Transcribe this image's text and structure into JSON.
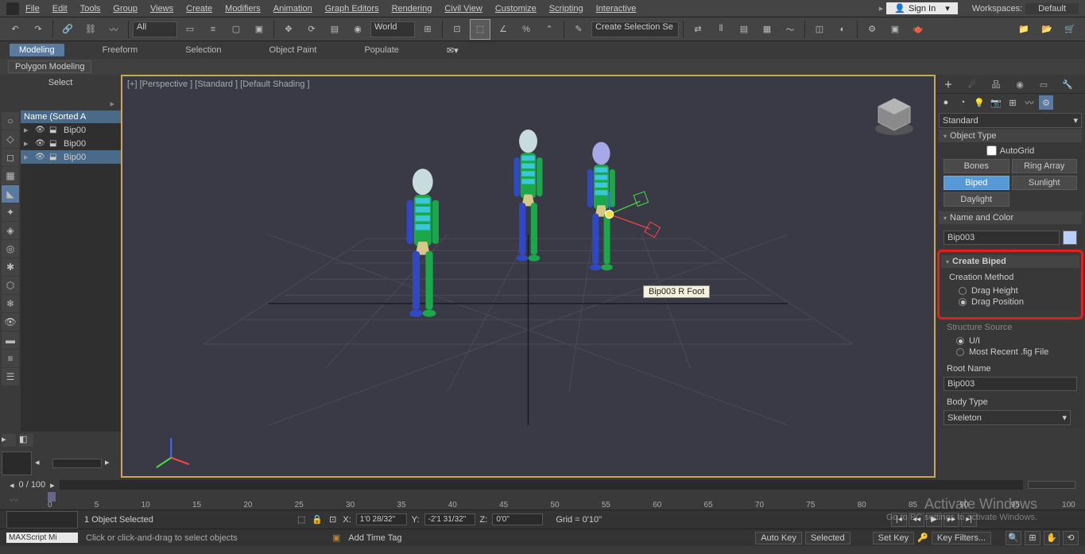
{
  "menu": {
    "items": [
      "File",
      "Edit",
      "Tools",
      "Group",
      "Views",
      "Create",
      "Modifiers",
      "Animation",
      "Graph Editors",
      "Rendering",
      "Civil View",
      "Customize",
      "Scripting",
      "Interactive"
    ],
    "signin": "Sign In",
    "workspaces_label": "Workspaces:",
    "workspaces_value": "Default"
  },
  "toolbar": {
    "selection_filter": "All",
    "coord_system": "World",
    "selection_set": "Create Selection Se"
  },
  "modes": {
    "items": [
      "Modeling",
      "Freeform",
      "Selection",
      "Object Paint",
      "Populate"
    ],
    "active": 0
  },
  "submodes": {
    "label": "Polygon Modeling"
  },
  "left": {
    "title": "Select",
    "header": "Name (Sorted A"
  },
  "scene": {
    "items": [
      {
        "name": "Bip00",
        "selected": false
      },
      {
        "name": "Bip00",
        "selected": false
      },
      {
        "name": "Bip00",
        "selected": true
      }
    ]
  },
  "viewport": {
    "label": "[+] [Perspective ] [Standard ] [Default Shading ]",
    "tooltip": "Bip003 R Foot"
  },
  "right": {
    "dropdown": "Standard",
    "object_type": {
      "title": "Object Type",
      "autogrid": "AutoGrid",
      "buttons": [
        "Bones",
        "Ring Array",
        "Biped",
        "Sunlight",
        "Daylight"
      ],
      "active": "Biped"
    },
    "name_color": {
      "title": "Name and Color",
      "value": "Bip003"
    },
    "create_biped": {
      "title": "Create Biped",
      "creation_method": "Creation Method",
      "opt1": "Drag Height",
      "opt2": "Drag Position",
      "structure_source": "Structure Source",
      "ss1": "U/I",
      "ss2": "Most Recent .fig File",
      "root_name_label": "Root Name",
      "root_name": "Bip003",
      "body_type_label": "Body Type",
      "body_type": "Skeleton"
    }
  },
  "slider": {
    "label": "0 / 100"
  },
  "timeline": {
    "ticks": [
      "0",
      "5",
      "10",
      "15",
      "20",
      "25",
      "30",
      "35",
      "40",
      "45",
      "50",
      "55",
      "60",
      "65",
      "70",
      "75",
      "80",
      "85",
      "90",
      "95",
      "100"
    ]
  },
  "status": {
    "msg": "1 Object Selected",
    "x_label": "X:",
    "x": "1'0 28/32\"",
    "y_label": "Y:",
    "y": "-2'1 31/32\"",
    "z_label": "Z:",
    "z": "0'0\"",
    "grid": "Grid = 0'10\"",
    "add_time_tag": "Add Time Tag"
  },
  "status2": {
    "script": "MAXScript Mi",
    "hint": "Click or click-and-drag to select objects",
    "auto_key": "Auto Key",
    "selected": "Selected",
    "set_key": "Set Key",
    "key_filters": "Key Filters..."
  },
  "watermark": {
    "line1": "Activate Windows",
    "line2": "Go to PC settings to activate Windows."
  }
}
